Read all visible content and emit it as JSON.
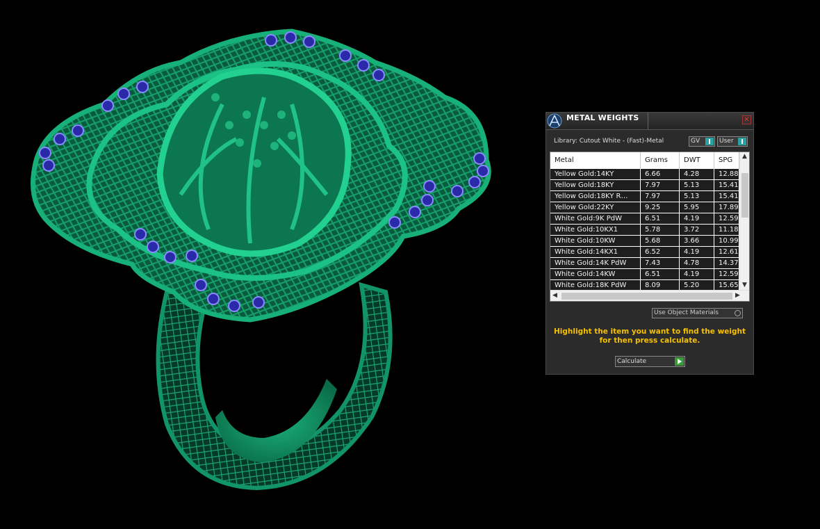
{
  "panel": {
    "title": "METAL WEIGHTS",
    "library_label": "Library: Cutout White - (Fast)-Metal",
    "toggles": [
      {
        "label": "GV"
      },
      {
        "label": "User"
      }
    ],
    "table": {
      "columns": [
        "Metal",
        "Grams",
        "DWT",
        "SPG"
      ],
      "rows": [
        [
          "Yellow Gold:14KY",
          "6.66",
          "4.28",
          "12.88"
        ],
        [
          "Yellow Gold:18KY",
          "7.97",
          "5.13",
          "15.41"
        ],
        [
          "Yellow Gold:18KY R…",
          "7.97",
          "5.13",
          "15.41"
        ],
        [
          "Yellow Gold:22KY",
          "9.25",
          "5.95",
          "17.89"
        ],
        [
          "White Gold:9K PdW",
          "6.51",
          "4.19",
          "12.59"
        ],
        [
          "White Gold:10KX1",
          "5.78",
          "3.72",
          "11.18"
        ],
        [
          "White Gold:10KW",
          "5.68",
          "3.66",
          "10.99"
        ],
        [
          "White Gold:14KX1",
          "6.52",
          "4.19",
          "12.61"
        ],
        [
          "White Gold:14K PdW",
          "7.43",
          "4.78",
          "14.37"
        ],
        [
          "White Gold:14KW",
          "6.51",
          "4.19",
          "12.59"
        ],
        [
          "White Gold:18K PdW",
          "8.09",
          "5.20",
          "15.65"
        ]
      ]
    },
    "use_object_materials": "Use Object Materials",
    "hint_line1": "Highlight the item you want to find the weight",
    "hint_line2": "for then press calculate.",
    "calculate_label": "Calculate",
    "colors": {
      "panel_bg": "#2b2b2b",
      "hint": "#f5c000",
      "toggle_accent": "#2aa0a0",
      "go_button": "#3a9a3a",
      "close": "#e33333"
    }
  },
  "viewport": {
    "model_colors": {
      "metal": "#0e8a5e",
      "gem": "#2a2aa8"
    }
  }
}
